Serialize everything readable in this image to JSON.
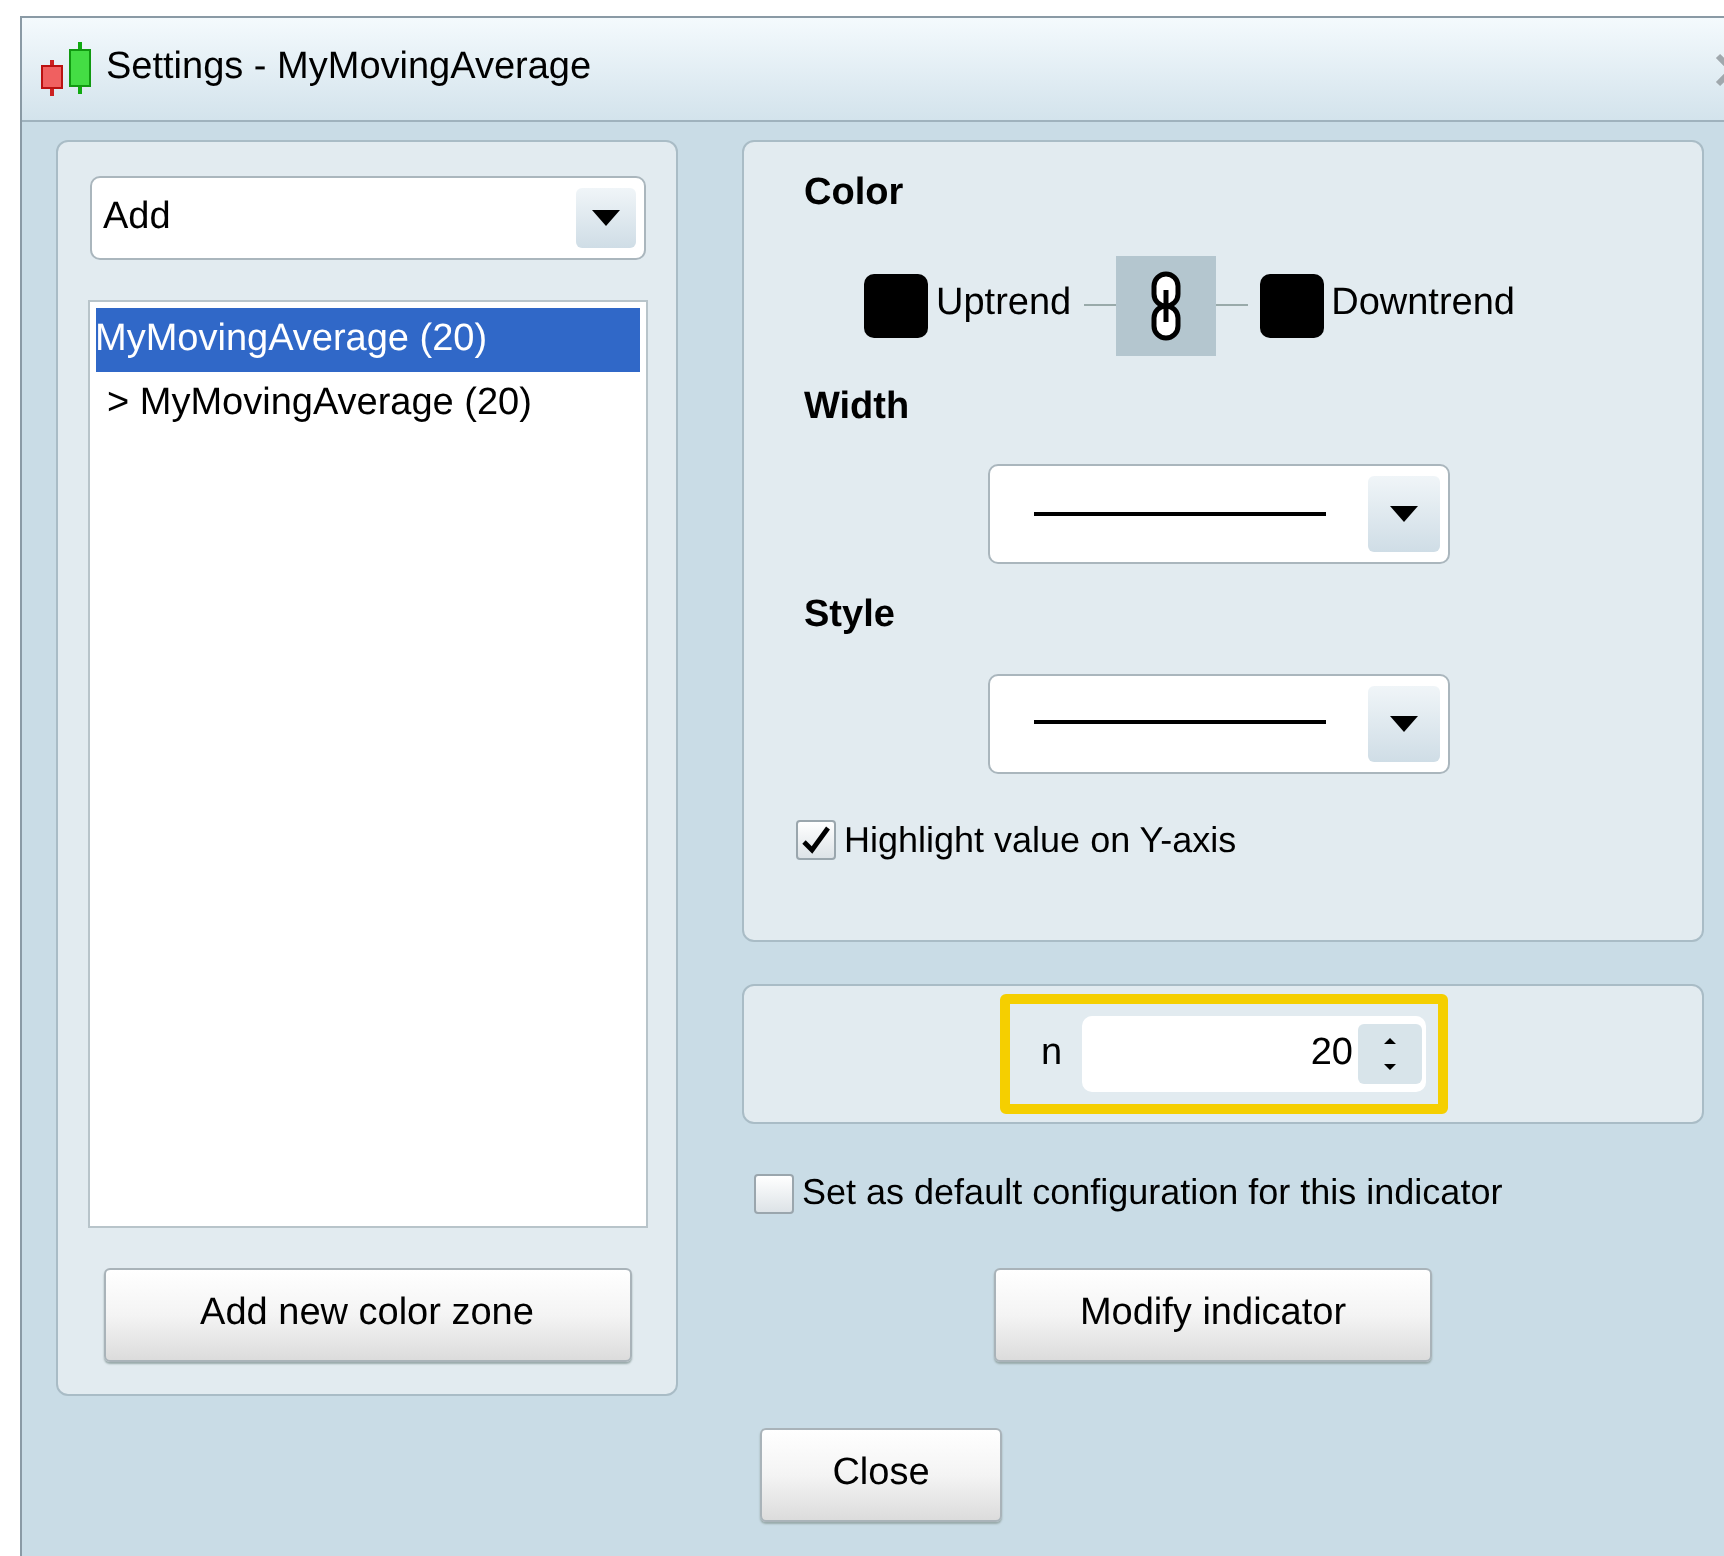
{
  "window": {
    "title": "Settings - MyMovingAverage"
  },
  "left_panel": {
    "add_dropdown": {
      "value": "Add"
    },
    "list": [
      {
        "label": "MyMovingAverage (20)",
        "selected": true
      },
      {
        "label": "> MyMovingAverage (20)",
        "selected": false
      }
    ],
    "add_zone_button": "Add new color zone"
  },
  "color_section": {
    "heading": "Color",
    "uptrend": {
      "label": "Uptrend",
      "color": "#000000"
    },
    "linked": true,
    "downtrend": {
      "label": "Downtrend",
      "color": "#000000"
    }
  },
  "width_section": {
    "heading": "Width"
  },
  "style_section": {
    "heading": "Style"
  },
  "highlight_checkbox": {
    "label": "Highlight value on Y-axis",
    "checked": true
  },
  "parameter": {
    "label": "n",
    "value": "20"
  },
  "default_checkbox": {
    "label": "Set as default configuration for this indicator",
    "checked": false
  },
  "modify_button": "Modify indicator",
  "close_button": "Close"
}
